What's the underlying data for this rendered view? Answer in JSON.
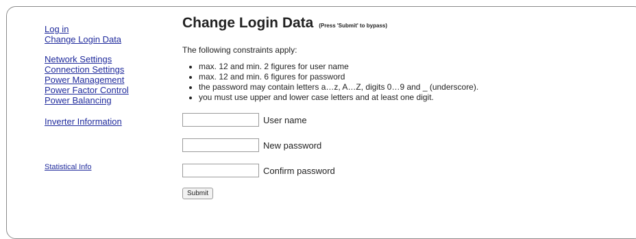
{
  "sidebar": {
    "login": "Log in",
    "change_login": "Change Login Data",
    "network": "Network Settings",
    "connection": "Connection Settings",
    "power_mgmt": "Power Management",
    "power_factor": "Power Factor Control",
    "power_balancing": "Power Balancing",
    "inverter_info": "Inverter Information",
    "statistical_info": "Statistical Info"
  },
  "main": {
    "title": "Change Login Data",
    "title_note": "(Press 'Submit' to bypass)",
    "intro": "The following constraints apply:",
    "constraints": [
      "max. 12 and min. 2 figures for user name",
      "max. 12 and min. 6 figures for password",
      "the password may contain letters a…z, A…Z, digits 0…9 and _ (underscore).",
      "you must use upper and lower case letters and at least one digit."
    ],
    "fields": {
      "user_name_label": "User name",
      "new_password_label": "New password",
      "confirm_password_label": "Confirm password"
    },
    "submit_label": "Submit"
  }
}
